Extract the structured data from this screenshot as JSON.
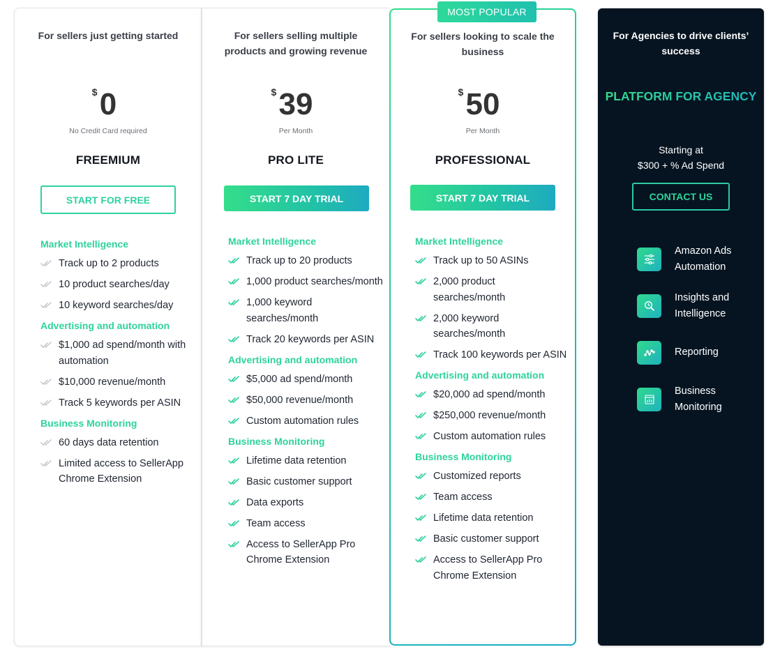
{
  "colors": {
    "accent_green": "#2ed39a",
    "accent_teal": "#1eaac0",
    "agency_bg": "#061421",
    "check_muted": "#c8ccd2",
    "check_active": "#2ed1a0"
  },
  "plans": [
    {
      "id": "freemium",
      "tagline": "For sellers just getting started",
      "currency": "$",
      "price": "0",
      "price_sub": "No Credit Card required",
      "name": "FREEMIUM",
      "cta": "START FOR FREE",
      "check_style": "muted",
      "sections": [
        {
          "title": "Market Intelligence",
          "items": [
            "Track up to 2 products",
            "10 product searches/day",
            "10 keyword searches/day"
          ]
        },
        {
          "title": "Advertising and automation",
          "items": [
            "$1,000 ad spend/month with automation",
            "$10,000 revenue/month",
            "Track 5 keywords per ASIN"
          ]
        },
        {
          "title": "Business Monitoring",
          "items": [
            "60 days data retention",
            "Limited access to SellerApp Chrome Extension"
          ]
        }
      ]
    },
    {
      "id": "pro-lite",
      "tagline": "For sellers selling multiple products and growing revenue",
      "currency": "$",
      "price": "39",
      "price_sub": "Per Month",
      "name": "PRO LITE",
      "cta": "START 7 DAY TRIAL",
      "check_style": "active",
      "sections": [
        {
          "title": "Market Intelligence",
          "items": [
            "Track up to 20 products",
            "1,000 product searches/month",
            "1,000 keyword searches/month",
            "Track 20 keywords per ASIN"
          ]
        },
        {
          "title": "Advertising and automation",
          "items": [
            "$5,000 ad spend/month",
            "$50,000 revenue/month",
            "Custom automation rules"
          ]
        },
        {
          "title": "Business Monitoring",
          "items": [
            "Lifetime data retention",
            "Basic customer support",
            "Data exports",
            "Team access",
            "Access to SellerApp Pro Chrome Extension"
          ]
        }
      ]
    },
    {
      "id": "professional",
      "badge": "MOST POPULAR",
      "tagline": "For sellers looking to scale the business",
      "currency": "$",
      "price": "50",
      "price_sub": "Per Month",
      "name": "PROFESSIONAL",
      "cta": "START 7 DAY TRIAL",
      "check_style": "active",
      "sections": [
        {
          "title": "Market Intelligence",
          "items": [
            "Track up to 50 ASINs",
            "2,000 product searches/month",
            "2,000 keyword searches/month",
            "Track 100 keywords per ASIN"
          ]
        },
        {
          "title": "Advertising and automation",
          "items": [
            "$20,000 ad spend/month",
            "$250,000 revenue/month",
            "Custom automation rules"
          ]
        },
        {
          "title": "Business Monitoring",
          "items": [
            "Customized reports",
            "Team access",
            "Lifetime data retention",
            "Basic customer support",
            "Access to SellerApp Pro Chrome Extension"
          ]
        }
      ]
    }
  ],
  "agency": {
    "tagline": "For Agencies to drive clients’ success",
    "title": "PLATFORM FOR AGENCY",
    "starting_label": "Starting at",
    "starting_price": "$300 + % Ad Spend",
    "cta": "CONTACT US",
    "features": [
      {
        "icon": "sliders-icon",
        "label": "Amazon Ads Automation"
      },
      {
        "icon": "search-insights-icon",
        "label": "Insights and Intelligence"
      },
      {
        "icon": "line-chart-icon",
        "label": "Reporting"
      },
      {
        "icon": "dashboard-icon",
        "label": "Business Monitoring"
      }
    ]
  }
}
